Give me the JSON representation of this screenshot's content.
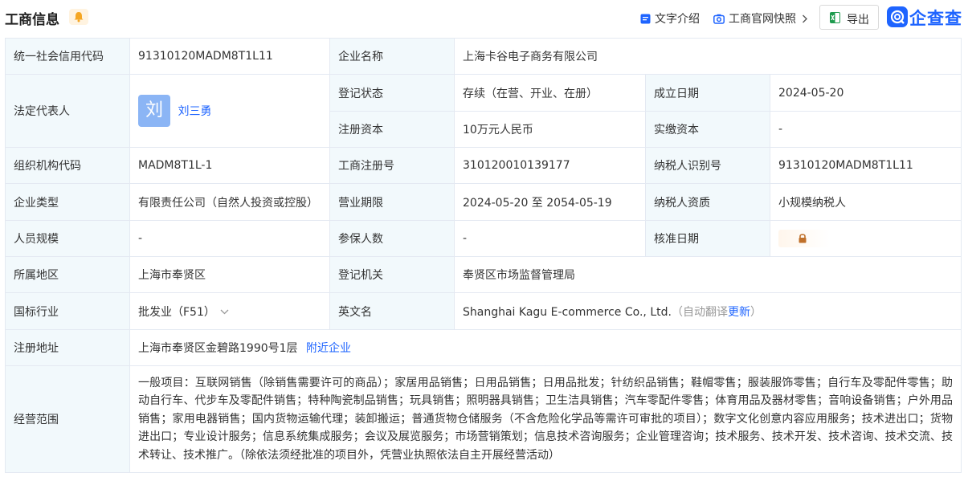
{
  "header": {
    "title": "工商信息",
    "text_intro": "文字介绍",
    "snapshot": "工商官网快照",
    "export": "导出",
    "logo_text": "企查查"
  },
  "colors": {
    "accent": "#1e64ff",
    "label_bg": "#f2f9fc",
    "border": "#e4e9f2",
    "bell": "#f5a623"
  },
  "rows": {
    "credit_code_label": "统一社会信用代码",
    "credit_code": "91310120MADM8T1L11",
    "company_name_label": "企业名称",
    "company_name": "上海卡谷电子商务有限公司",
    "legal_rep_label": "法定代表人",
    "legal_rep_avatar": "刘",
    "legal_rep": "刘三勇",
    "reg_status_label": "登记状态",
    "reg_status": "存续（在营、开业、在册）",
    "found_date_label": "成立日期",
    "found_date": "2024-05-20",
    "reg_capital_label": "注册资本",
    "reg_capital": "10万元人民币",
    "paid_capital_label": "实缴资本",
    "paid_capital": "-",
    "org_code_label": "组织机构代码",
    "org_code": "MADM8T1L-1",
    "reg_no_label": "工商注册号",
    "reg_no": "310120010139177",
    "taxpayer_id_label": "纳税人识别号",
    "taxpayer_id": "91310120MADM8T1L11",
    "company_type_label": "企业类型",
    "company_type": "有限责任公司（自然人投资或控股）",
    "biz_term_label": "营业期限",
    "biz_term": "2024-05-20 至 2054-05-19",
    "tax_qual_label": "纳税人资质",
    "tax_qual": "小规模纳税人",
    "staff_size_label": "人员规模",
    "staff_size": "-",
    "insured_label": "参保人数",
    "insured": "-",
    "approve_date_label": "核准日期",
    "region_label": "所属地区",
    "region": "上海市奉贤区",
    "reg_authority_label": "登记机关",
    "reg_authority": "奉贤区市场监督管理局",
    "industry_label": "国标行业",
    "industry": "批发业（F51）",
    "english_name_label": "英文名",
    "english_name": "Shanghai Kagu E-commerce Co., Ltd.",
    "english_note_open": "（自动翻译",
    "english_update": "更新",
    "english_note_close": "）",
    "address_label": "注册地址",
    "address": "上海市奉贤区金碧路1990号1层",
    "nearby": "附近企业",
    "scope_label": "经营范围",
    "scope": "一般项目：互联网销售（除销售需要许可的商品）；家居用品销售；日用品销售；日用品批发；针纺织品销售；鞋帽零售；服装服饰零售；自行车及零配件零售；助动自行车、代步车及零配件销售；特种陶瓷制品销售；玩具销售；照明器具销售；卫生洁具销售；汽车零配件零售；体育用品及器材零售；音响设备销售；户外用品销售；家用电器销售；国内货物运输代理；装卸搬运；普通货物仓储服务（不含危险化学品等需许可审批的项目）；数字文化创意内容应用服务；技术进出口；货物进出口；专业设计服务；信息系统集成服务；会议及展览服务；市场营销策划；信息技术咨询服务；企业管理咨询；技术服务、技术开发、技术咨询、技术交流、技术转让、技术推广。（除依法须经批准的项目外，凭营业执照依法自主开展经营活动）"
  }
}
